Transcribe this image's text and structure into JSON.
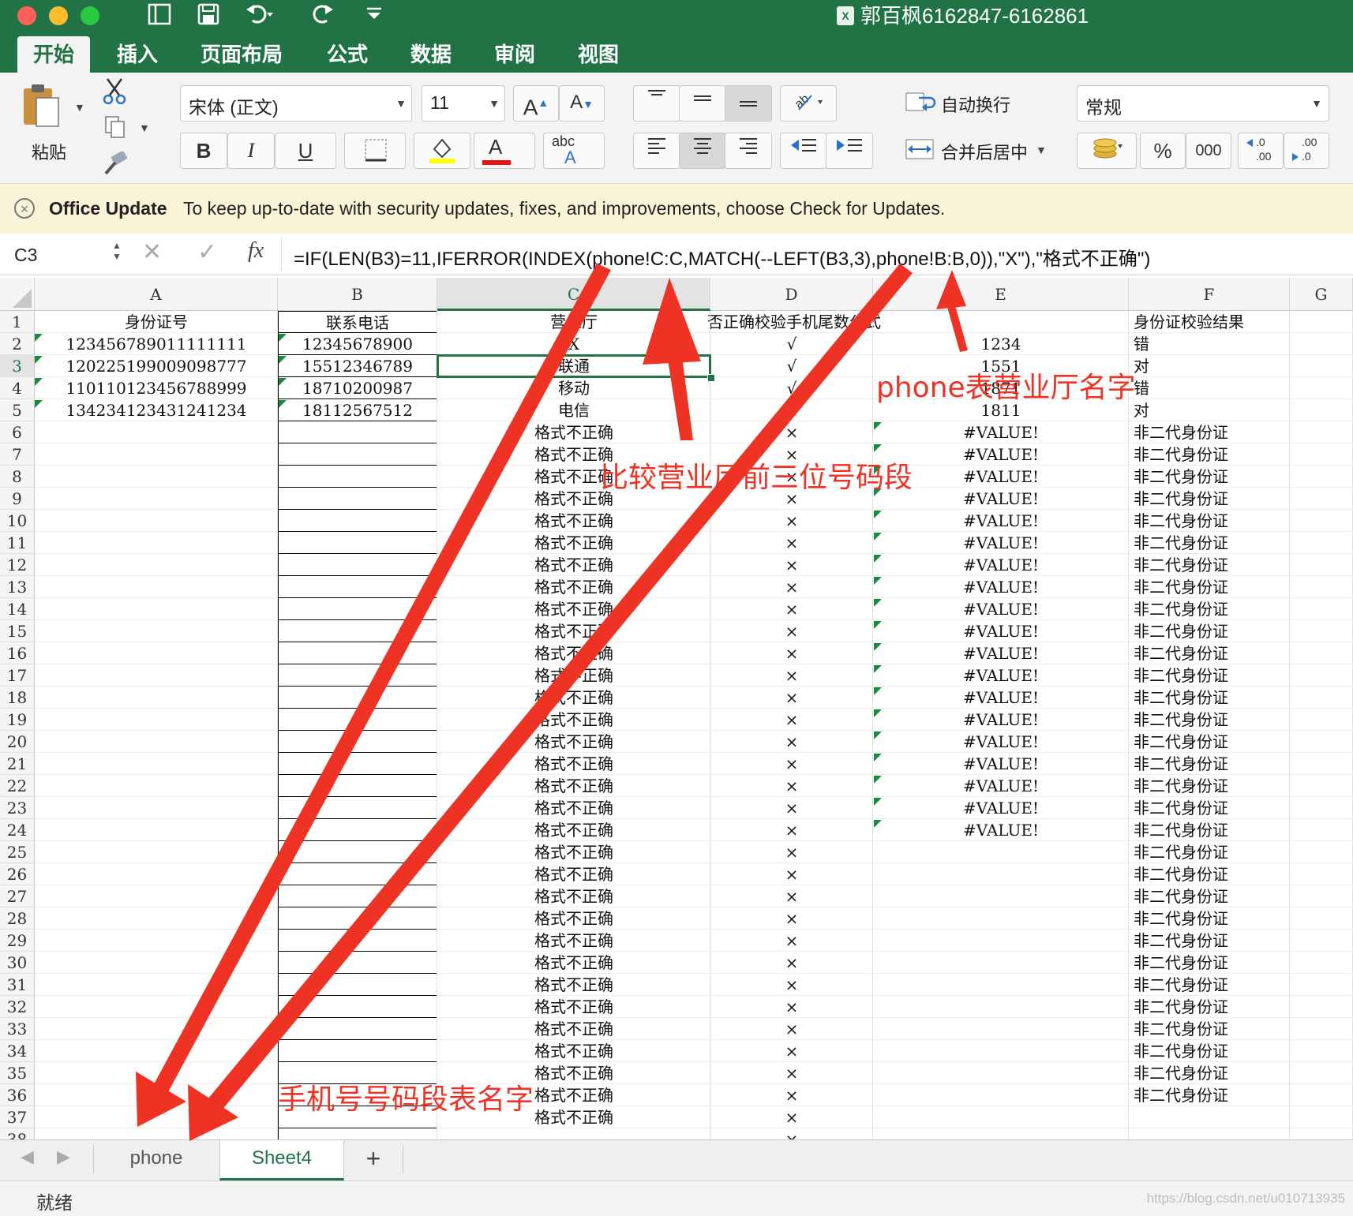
{
  "window": {
    "title": "郭百枫6162847-6162861",
    "file_icon_label": "X"
  },
  "quick_access": {
    "sidebar_icon": "sidebar-icon",
    "save_icon": "save-icon",
    "undo_icon": "undo-icon",
    "redo_icon": "redo-icon",
    "customize_icon": "customize-icon"
  },
  "ribbon_tabs": [
    "开始",
    "插入",
    "页面布局",
    "公式",
    "数据",
    "审阅",
    "视图"
  ],
  "ribbon": {
    "paste_label": "粘贴",
    "font_name": "宋体 (正文)",
    "font_size": "11",
    "bold": "B",
    "italic": "I",
    "underline": "U",
    "font_color_letter": "A",
    "abc": "abc",
    "wrap_text": "自动换行",
    "merge_center": "合并后居中",
    "number_format": "常规",
    "percent": "%",
    "thousands": "000",
    "inc_decimal": ".0\n.00",
    "dec_decimal": ".00\n.0",
    "accent_color": "#217346"
  },
  "update_bar": {
    "title": "Office Update",
    "message": "To keep up-to-date with security updates, fixes, and improvements, choose Check for Updates."
  },
  "formula_bar": {
    "name_box": "C3",
    "fx": "fx",
    "formula": "=IF(LEN(B3)=11,IFERROR(INDEX(phone!C:C,MATCH(--LEFT(B3,3),phone!B:B,0)),\"X\"),\"格式不正确\")"
  },
  "columns": [
    "A",
    "B",
    "C",
    "D",
    "E",
    "F",
    "G"
  ],
  "selected_cell": {
    "column": "C",
    "row": 3
  },
  "header_row": {
    "A": "身份证号",
    "B": "联系电话",
    "C": "营业厅",
    "D": "否正确校验手机尾数公式",
    "E": "",
    "F": "身份证校验结果"
  },
  "rows": [
    {
      "n": "2",
      "A": "123456789011111111",
      "B": "12345678900",
      "C": "X",
      "D": "√",
      "E": "1234",
      "F": "错"
    },
    {
      "n": "3",
      "A": "120225199009098777",
      "B": "15512346789",
      "C": "联通",
      "D": "√",
      "E": "1551",
      "F": "对"
    },
    {
      "n": "4",
      "A": "110110123456788999",
      "B": "18710200987",
      "C": "移动",
      "D": "√",
      "E": "1871",
      "F": "错"
    },
    {
      "n": "5",
      "A": "134234123431241234",
      "B": "18112567512",
      "C": "电信",
      "D": "√",
      "E": "1811",
      "F": "对"
    },
    {
      "n": "6",
      "C": "格式不正确",
      "D": "×",
      "E": "#VALUE!",
      "F": "非二代身份证"
    },
    {
      "n": "7",
      "C": "格式不正确",
      "D": "×",
      "E": "#VALUE!",
      "F": "非二代身份证"
    },
    {
      "n": "8",
      "C": "格式不正确",
      "D": "×",
      "E": "#VALUE!",
      "F": "非二代身份证"
    },
    {
      "n": "9",
      "C": "格式不正确",
      "D": "×",
      "E": "#VALUE!",
      "F": "非二代身份证"
    },
    {
      "n": "10",
      "C": "格式不正确",
      "D": "×",
      "E": "#VALUE!",
      "F": "非二代身份证"
    },
    {
      "n": "11",
      "C": "格式不正确",
      "D": "×",
      "E": "#VALUE!",
      "F": "非二代身份证"
    },
    {
      "n": "12",
      "C": "格式不正确",
      "D": "×",
      "E": "#VALUE!",
      "F": "非二代身份证"
    },
    {
      "n": "13",
      "C": "格式不正确",
      "D": "×",
      "E": "#VALUE!",
      "F": "非二代身份证"
    },
    {
      "n": "14",
      "C": "格式不正确",
      "D": "×",
      "E": "#VALUE!",
      "F": "非二代身份证"
    },
    {
      "n": "15",
      "C": "格式不正确",
      "D": "×",
      "E": "#VALUE!",
      "F": "非二代身份证"
    },
    {
      "n": "16",
      "C": "格式不正确",
      "D": "×",
      "E": "#VALUE!",
      "F": "非二代身份证"
    },
    {
      "n": "17",
      "C": "格式不正确",
      "D": "×",
      "E": "#VALUE!",
      "F": "非二代身份证"
    },
    {
      "n": "18",
      "C": "格式不正确",
      "D": "×",
      "E": "#VALUE!",
      "F": "非二代身份证"
    },
    {
      "n": "19",
      "C": "格式不正确",
      "D": "×",
      "E": "#VALUE!",
      "F": "非二代身份证"
    },
    {
      "n": "20",
      "C": "格式不正确",
      "D": "×",
      "E": "#VALUE!",
      "F": "非二代身份证"
    },
    {
      "n": "21",
      "C": "格式不正确",
      "D": "×",
      "E": "#VALUE!",
      "F": "非二代身份证"
    },
    {
      "n": "22",
      "C": "格式不正确",
      "D": "×",
      "E": "#VALUE!",
      "F": "非二代身份证"
    },
    {
      "n": "23",
      "C": "格式不正确",
      "D": "×",
      "E": "#VALUE!",
      "F": "非二代身份证"
    },
    {
      "n": "24",
      "C": "格式不正确",
      "D": "×",
      "E": "#VALUE!",
      "F": "非二代身份证"
    },
    {
      "n": "25",
      "C": "格式不正确",
      "D": "×",
      "F": "非二代身份证"
    },
    {
      "n": "26",
      "C": "格式不正确",
      "D": "×",
      "F": "非二代身份证"
    },
    {
      "n": "27",
      "C": "格式不正确",
      "D": "×",
      "F": "非二代身份证"
    },
    {
      "n": "28",
      "C": "格式不正确",
      "D": "×",
      "F": "非二代身份证"
    },
    {
      "n": "29",
      "C": "格式不正确",
      "D": "×",
      "F": "非二代身份证"
    },
    {
      "n": "30",
      "C": "格式不正确",
      "D": "×",
      "F": "非二代身份证"
    },
    {
      "n": "31",
      "C": "格式不正确",
      "D": "×",
      "F": "非二代身份证"
    },
    {
      "n": "32",
      "C": "格式不正确",
      "D": "×",
      "F": "非二代身份证"
    },
    {
      "n": "33",
      "C": "格式不正确",
      "D": "×",
      "F": "非二代身份证"
    },
    {
      "n": "34",
      "C": "格式不正确",
      "D": "×",
      "F": "非二代身份证"
    },
    {
      "n": "35",
      "C": "格式不正确",
      "D": "×",
      "F": "非二代身份证"
    },
    {
      "n": "36",
      "C": "格式不正确",
      "D": "×",
      "F": "非二代身份证"
    },
    {
      "n": "37",
      "C": "格式不正确",
      "D": "×"
    },
    {
      "n": "38",
      "D": "×"
    }
  ],
  "sheet_tabs": [
    "phone",
    "Sheet4"
  ],
  "active_sheet": "Sheet4",
  "add_sheet": "+",
  "status_bar": {
    "text": "就绪"
  },
  "watermark": "https://blog.csdn.net/u010713935",
  "annotations": {
    "color": "#ee3224",
    "texts": [
      "phone表营业厅名字",
      "比较营业厅前三位号码段",
      "手机号号码段表名字"
    ]
  }
}
